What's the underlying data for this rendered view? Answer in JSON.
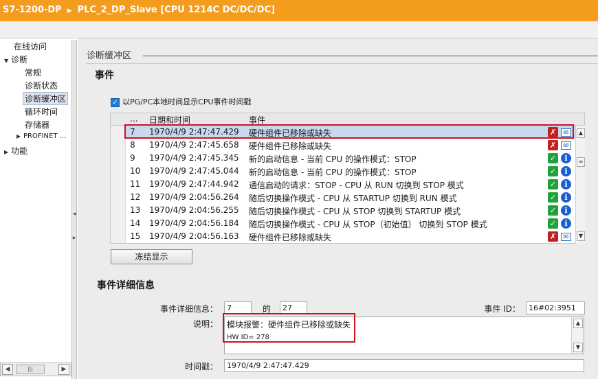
{
  "title_bar": {
    "device": "S7-1200-DP",
    "separator": "▶",
    "station": "PLC_2_DP_Slave [CPU 1214C DC/DC/DC]"
  },
  "nav": {
    "items": [
      {
        "label": "在线访问",
        "level": 1,
        "arrow": ""
      },
      {
        "label": "诊断",
        "level": 0,
        "arrow": "▼"
      },
      {
        "label": "常规",
        "level": 2,
        "arrow": ""
      },
      {
        "label": "诊断状态",
        "level": 2,
        "arrow": ""
      },
      {
        "label": "诊断缓冲区",
        "level": 2,
        "arrow": "",
        "selected": true
      },
      {
        "label": "循环时间",
        "level": 2,
        "arrow": ""
      },
      {
        "label": "存储器",
        "level": 2,
        "arrow": ""
      },
      {
        "label": "PROFINET ...",
        "level": 1,
        "arrow": "▶"
      },
      {
        "label": "功能",
        "level": 0,
        "arrow": "▶"
      }
    ]
  },
  "section": {
    "heading": "诊断缓冲区",
    "events_title": "事件",
    "checkbox_label": "以PG/PC本地时间显示CPU事件时间戳",
    "checkbox_checked": true
  },
  "table": {
    "columns": [
      "...",
      "日期和时间",
      "事件"
    ],
    "rows": [
      {
        "no": "7",
        "datetime": "1970/4/9 2:47:47.429",
        "event": "硬件组件已移除或缺失",
        "icon1": "tool-error-icon",
        "icon2": "mail-incoming-icon",
        "selected": true
      },
      {
        "no": "8",
        "datetime": "1970/4/9 2:47:45.658",
        "event": "硬件组件已移除或缺失",
        "icon1": "tool-error-icon",
        "icon2": "mail-outgoing-icon"
      },
      {
        "no": "9",
        "datetime": "1970/4/9 2:47:45.345",
        "event": "新的启动信息 - 当前 CPU 的操作模式：STOP",
        "icon1": "check-icon",
        "icon2": "info-icon"
      },
      {
        "no": "10",
        "datetime": "1970/4/9 2:47:45.044",
        "event": "新的启动信息 - 当前 CPU 的操作模式：STOP",
        "icon1": "check-icon",
        "icon2": "info-icon"
      },
      {
        "no": "11",
        "datetime": "1970/4/9 2:47:44.942",
        "event": "通信启动的请求：STOP - CPU 从 RUN 切换到 STOP 模式",
        "icon1": "check-icon",
        "icon2": "info-icon"
      },
      {
        "no": "12",
        "datetime": "1970/4/9 2:04:56.264",
        "event": "随后切换操作模式 - CPU 从 STARTUP 切换到 RUN 模式",
        "icon1": "check-icon",
        "icon2": "info-icon"
      },
      {
        "no": "13",
        "datetime": "1970/4/9 2:04:56.255",
        "event": "随后切换操作模式 - CPU 从 STOP 切换到 STARTUP 模式",
        "icon1": "check-icon",
        "icon2": "info-icon"
      },
      {
        "no": "14",
        "datetime": "1970/4/9 2:04:56.184",
        "event": "随后切换操作模式 - CPU 从 STOP（初始值） 切换到 STOP 模式",
        "icon1": "check-icon",
        "icon2": "info-icon"
      },
      {
        "no": "15",
        "datetime": "1970/4/9 2:04:56.163",
        "event": "硬件组件已移除或缺失",
        "icon1": "tool-error-icon",
        "icon2": "mail-incoming-icon"
      }
    ]
  },
  "freeze_button": "冻结显示",
  "details": {
    "title": "事件详细信息",
    "info_label": "事件详细信息：",
    "index": "7",
    "of_label": "的",
    "total": "27",
    "event_id_label": "事件 ID：",
    "event_id": "16#02:3951",
    "desc_label": "说明：",
    "desc_line1": "模块报警：硬件组件已移除或缺失",
    "desc_line2": "HW ID=   278",
    "timestamp_label": "时间戳：",
    "timestamp": "1970/4/9 2:47:47.429"
  },
  "colors": {
    "title_bar": "#f39c1d",
    "selection": "#c8d8ef",
    "highlight_box": "#d0101e"
  }
}
